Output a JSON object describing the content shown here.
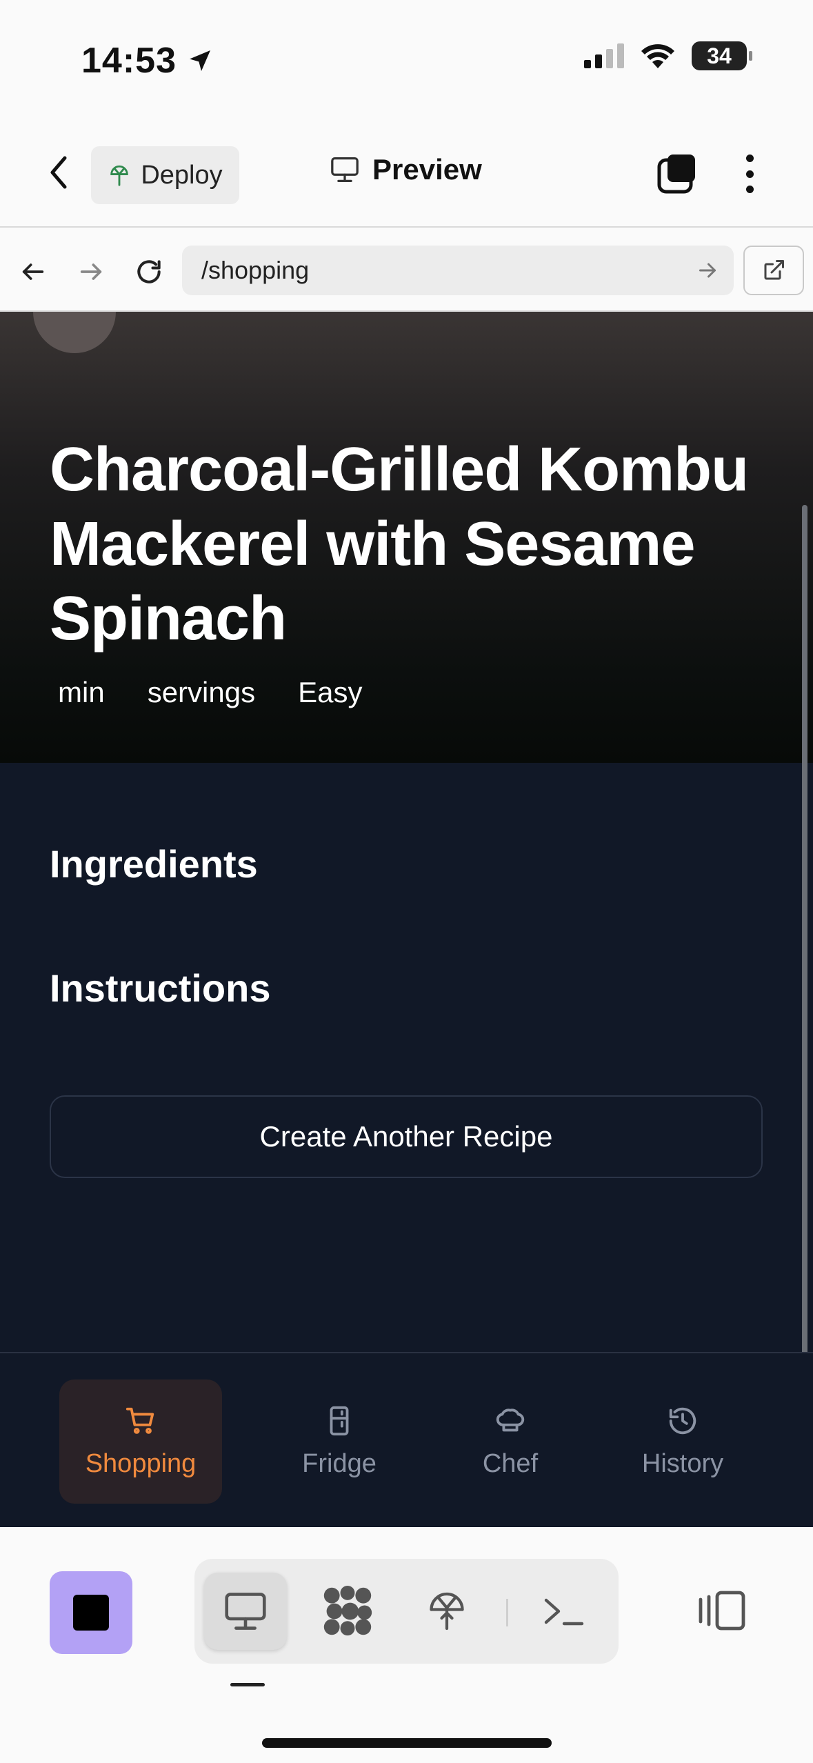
{
  "status_bar": {
    "time": "14:53",
    "battery": "34"
  },
  "header": {
    "deploy_label": "Deploy",
    "preview_label": "Preview"
  },
  "browser": {
    "url": "/shopping"
  },
  "recipe": {
    "title": "Charcoal-Grilled Kombu Mackerel with Sesame Spinach",
    "meta": {
      "time": "min",
      "servings": "servings",
      "difficulty": "Easy"
    },
    "ingredients_heading": "Ingredients",
    "instructions_heading": "Instructions",
    "create_another_label": "Create Another Recipe"
  },
  "tabs": [
    {
      "label": "Shopping",
      "icon": "cart-icon",
      "active": true
    },
    {
      "label": "Fridge",
      "icon": "fridge-icon",
      "active": false
    },
    {
      "label": "Chef",
      "icon": "chef-hat-icon",
      "active": false
    },
    {
      "label": "History",
      "icon": "history-icon",
      "active": false
    }
  ],
  "colors": {
    "accent": "#f08a3e",
    "page_bg": "#111827",
    "stop_button": "#b3a1f5"
  }
}
